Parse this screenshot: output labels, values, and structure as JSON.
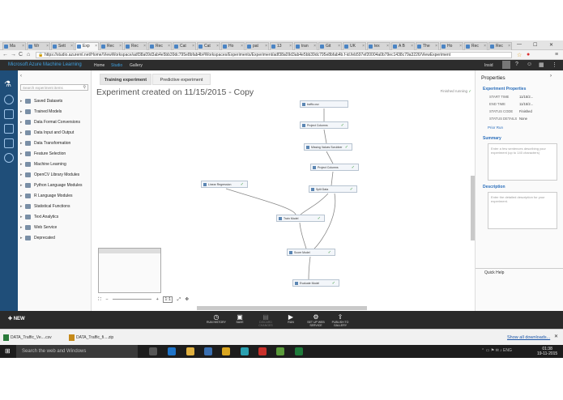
{
  "browser": {
    "tabs": [
      "Ma",
      "Wr",
      "Sett",
      "Exp",
      "Rec",
      "Rec",
      "Rec",
      "Cat",
      "Cat",
      "Ho",
      "pat",
      "13",
      "tran",
      "Git",
      "UK",
      "tex",
      "A B",
      "The",
      "Ho",
      "Rec",
      "Rec"
    ],
    "active_tab": "Exp",
    "user": "",
    "url": "https://studio.azureml.net/Home/ViewWorkspace/adf38a09d3ab4e5bb39dc795e8bfab4b#Workspaces/Experiments/Experiment/adf38a09d3ab4e5bb39dc795e8bfab4b.f-id.feb597ef20004a0b79ec1438c79a3226/ViewExperiment",
    "back": "←",
    "forward": "→",
    "reload": "C",
    "home": "⌂"
  },
  "app_header": {
    "brand_prefix": "Microsoft Azure",
    "brand_suffix": "Machine Learning",
    "nav": [
      "Home",
      "Studio",
      "Gallery"
    ],
    "user_label": "Insid"
  },
  "palette": {
    "search_placeholder": "Search experiment items",
    "items": [
      "Saved Datasets",
      "Trained Models",
      "Data Format Conversions",
      "Data Input and Output",
      "Data Transformation",
      "Feature Selection",
      "Machine Learning",
      "OpenCV Library Modules",
      "Python Language Modules",
      "R Language Modules",
      "Statistical Functions",
      "Text Analytics",
      "Web Service",
      "Deprecated"
    ]
  },
  "canvas": {
    "tabs": [
      "Training experiment",
      "Predictive experiment"
    ],
    "title": "Experiment created on 11/15/2015 - Copy",
    "status": "Finished running",
    "modules": [
      {
        "label": "traffic.csv"
      },
      {
        "label": "Project Columns"
      },
      {
        "label": "Missing Values Scrubber"
      },
      {
        "label": "Project Columns"
      },
      {
        "label": "Split Data"
      },
      {
        "label": "Linear Regression"
      },
      {
        "label": "Train Model"
      },
      {
        "label": "Score Model"
      },
      {
        "label": "Evaluate Model"
      }
    ],
    "zoom_controls": [
      "⛶",
      "−",
      "+",
      "1:1",
      "⤢",
      "✥"
    ]
  },
  "properties": {
    "title": "Properties",
    "section1": "Experiment Properties",
    "fields": [
      {
        "label": "START TIME",
        "value": "11/15/2..."
      },
      {
        "label": "END TIME",
        "value": "11/15/2..."
      },
      {
        "label": "STATUS CODE",
        "value": "Finished"
      },
      {
        "label": "STATUS DETAILS",
        "value": "None"
      }
    ],
    "prior_run": "Prior Run",
    "section2": "Summary",
    "summary_placeholder": "Enter a few sentences describing your experiment (up to 140 characters)",
    "section3": "Description",
    "description_placeholder": "Enter the detailed description for your experiment.",
    "quick_help": "Quick Help"
  },
  "action_bar": {
    "new_label": "NEW",
    "buttons": [
      {
        "label": "RUN HISTORY",
        "glyph": "◷"
      },
      {
        "label": "SAVE",
        "glyph": "▣"
      },
      {
        "label": "DISCARD CHANGES",
        "glyph": "▤"
      },
      {
        "label": "RUN",
        "glyph": "▶"
      },
      {
        "label": "SET UP WEB SERVICE",
        "glyph": "⚙"
      },
      {
        "label": "PUBLISH TO GALLERY",
        "glyph": "⇪"
      }
    ]
  },
  "downloads": {
    "files": [
      "DATA_Traffic_Ve....csv",
      "DATA_Traffic_fi....zip"
    ],
    "show_all": "Show all downloads..."
  },
  "taskbar": {
    "search": "Search the web and Windows",
    "time": "01:38",
    "date": "19-11-2015"
  }
}
